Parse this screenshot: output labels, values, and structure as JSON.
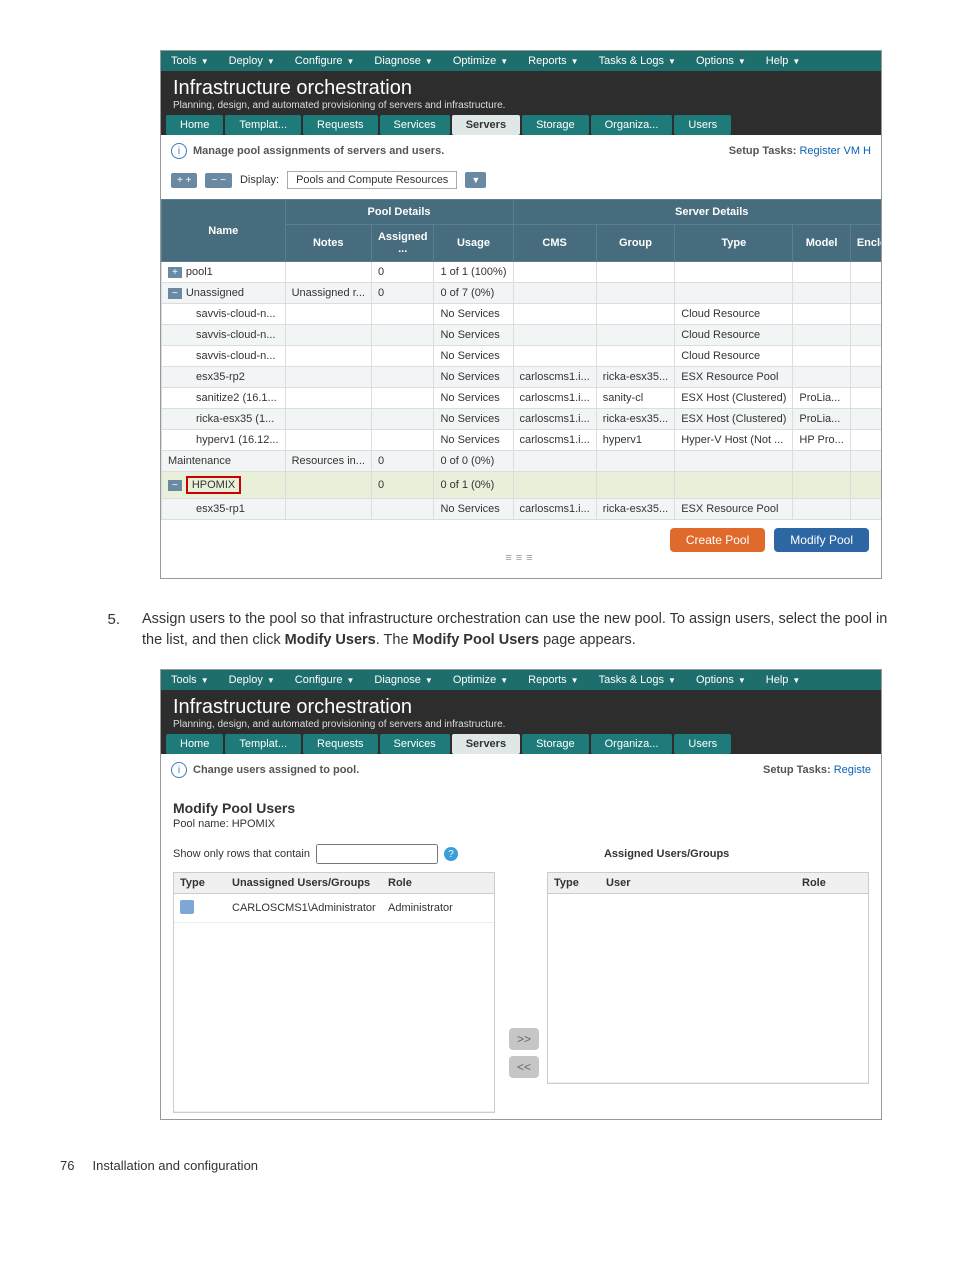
{
  "menu": [
    "Tools",
    "Deploy",
    "Configure",
    "Diagnose",
    "Optimize",
    "Reports",
    "Tasks & Logs",
    "Options",
    "Help"
  ],
  "title": "Infrastructure orchestration",
  "subtitle": "Planning, design, and automated provisioning of servers and infrastructure.",
  "tabs": [
    "Home",
    "Templat...",
    "Requests",
    "Services",
    "Servers",
    "Storage",
    "Organiza...",
    "Users"
  ],
  "activeTabIndex1": 4,
  "info1": "Manage pool assignments of servers and users.",
  "setupLabel": "Setup Tasks:",
  "setupLink1": "Register VM H",
  "displayLabel": "Display:",
  "displayValue": "Pools and Compute Resources",
  "poolHeader": "Pool Details",
  "serverHeader": "Server Details",
  "columns": {
    "name": "Name",
    "notes": "Notes",
    "assigned": "Assigned ...",
    "usage": "Usage",
    "cms": "CMS",
    "group": "Group",
    "type": "Type",
    "model": "Model",
    "enclosure": "Enclosur"
  },
  "rows": [
    {
      "name": "pool1",
      "expander": "+",
      "notes": "",
      "assigned": "0",
      "usage": "1 of 1 (100%)"
    },
    {
      "name": "Unassigned",
      "expander": "−",
      "notes": "Unassigned r...",
      "assigned": "0",
      "usage": "0 of 7 (0%)"
    },
    {
      "name": "savvis-cloud-n...",
      "child": true,
      "usage": "No Services",
      "type": "Cloud Resource"
    },
    {
      "name": "savvis-cloud-n...",
      "child": true,
      "usage": "No Services",
      "type": "Cloud Resource"
    },
    {
      "name": "savvis-cloud-n...",
      "child": true,
      "usage": "No Services",
      "type": "Cloud Resource"
    },
    {
      "name": "esx35-rp2",
      "child": true,
      "usage": "No Services",
      "cms": "carloscms1.i...",
      "group": "ricka-esx35...",
      "type": "ESX Resource Pool"
    },
    {
      "name": "sanitize2 (16.1...",
      "child": true,
      "usage": "No Services",
      "cms": "carloscms1.i...",
      "group": "sanity-cl",
      "type": "ESX Host (Clustered)",
      "model": "ProLia..."
    },
    {
      "name": "ricka-esx35 (1...",
      "child": true,
      "usage": "No Services",
      "cms": "carloscms1.i...",
      "group": "ricka-esx35...",
      "type": "ESX Host (Clustered)",
      "model": "ProLia..."
    },
    {
      "name": "hyperv1 (16.12...",
      "child": true,
      "usage": "No Services",
      "cms": "carloscms1.i...",
      "group": "hyperv1",
      "type": "Hyper-V Host (Not ...",
      "model": "HP Pro..."
    },
    {
      "name": "Maintenance",
      "notes": "Resources in...",
      "assigned": "0",
      "usage": "0 of 0 (0%)"
    },
    {
      "name": "HPOMIX",
      "expander": "−",
      "hpomix": true,
      "assigned": "0",
      "usage": "0 of 1 (0%)"
    },
    {
      "name": "esx35-rp1",
      "child": true,
      "usage": "No Services",
      "cms": "carloscms1.i...",
      "group": "ricka-esx35...",
      "type": "ESX Resource Pool"
    }
  ],
  "createBtn": "Create Pool",
  "modifyBtn": "Modify Pool",
  "step5": {
    "num": "5.",
    "text_a": "Assign users to the pool so that infrastructure orchestration can use the new pool. To assign users, select the pool in the list, and then click ",
    "bold_a": "Modify Users",
    "text_b": ". The ",
    "bold_b": "Modify Pool Users",
    "text_c": " page appears."
  },
  "info2": "Change users assigned to pool.",
  "setupLink2": "Registe",
  "modifyTitle": "Modify Pool Users",
  "poolNameLabel": "Pool name: HPOMIX",
  "filterLabel": "Show only rows that contain",
  "assignedLabel": "Assigned Users/Groups",
  "unassignedCols": {
    "type": "Type",
    "userGroup": "Unassigned Users/Groups",
    "role": "Role"
  },
  "assignedCols": {
    "type": "Type",
    "user": "User",
    "role": "Role"
  },
  "unassignedRow": {
    "user": "CARLOSCMS1\\Administrator",
    "role": "Administrator"
  },
  "moveRight": ">>",
  "moveLeft": "<<",
  "pageNum": "76",
  "pageSection": "Installation and configuration"
}
